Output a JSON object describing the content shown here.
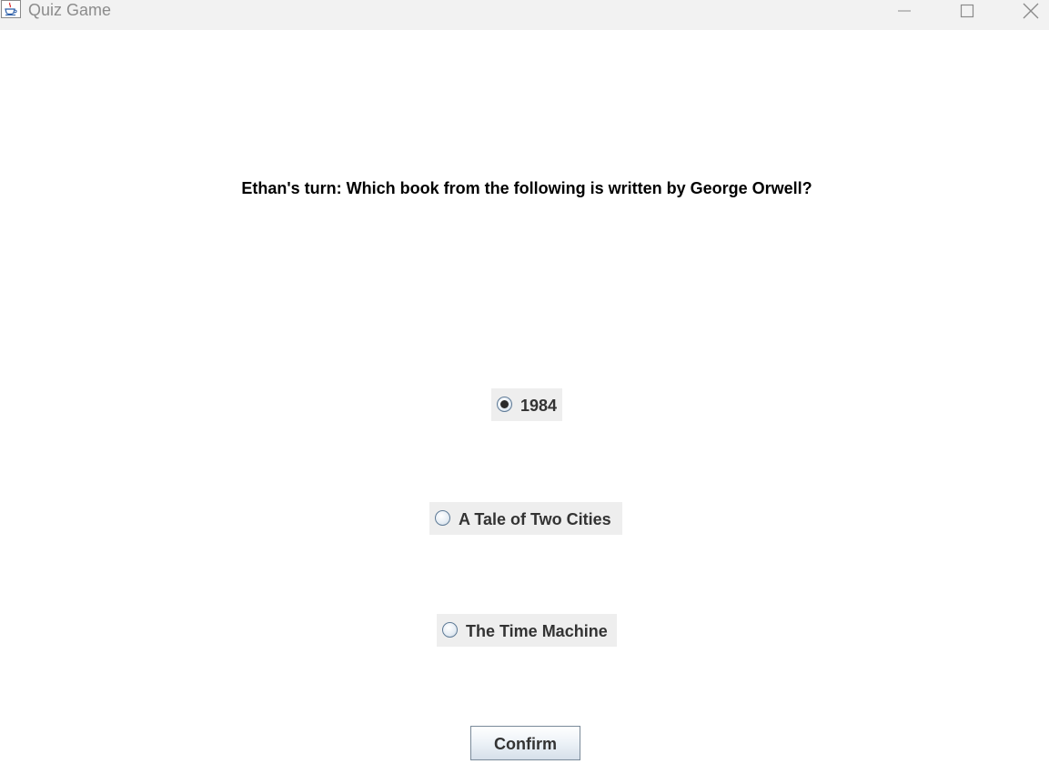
{
  "window": {
    "title": "Quiz Game"
  },
  "question": {
    "text": "Ethan's turn: Which book from the following is written by George Orwell?"
  },
  "options": [
    {
      "label": "1984",
      "selected": true
    },
    {
      "label": "A Tale of Two Cities",
      "selected": false
    },
    {
      "label": "The Time Machine",
      "selected": false
    }
  ],
  "confirm_button": {
    "label": "Confirm"
  },
  "icons": {
    "app": "java-coffee-icon",
    "minimize": "minimize-icon",
    "maximize": "maximize-icon",
    "close": "close-icon"
  }
}
